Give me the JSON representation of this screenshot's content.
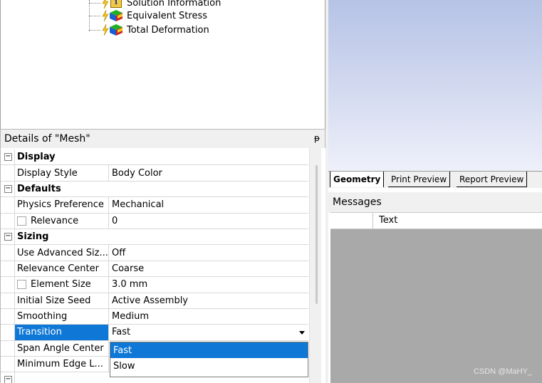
{
  "tree": {
    "items": [
      {
        "label": "Solution Information",
        "icon": "solution-information-icon"
      },
      {
        "label": "Equivalent Stress",
        "icon": "result-cube-icon"
      },
      {
        "label": "Total Deformation",
        "icon": "result-cube-icon"
      }
    ]
  },
  "details": {
    "title": "Details of \"Mesh\"",
    "pin_glyph": "ᵽ",
    "groups": {
      "display": "Display",
      "defaults": "Defaults",
      "sizing": "Sizing"
    },
    "rows": {
      "display_style": {
        "label": "Display Style",
        "value": "Body Color"
      },
      "physics_preference": {
        "label": "Physics Preference",
        "value": "Mechanical"
      },
      "relevance": {
        "label": "Relevance",
        "value": "0"
      },
      "use_advanced_size": {
        "label": "Use Advanced Siz...",
        "value": "Off"
      },
      "relevance_center": {
        "label": "Relevance Center",
        "value": "Coarse"
      },
      "element_size": {
        "label": "Element Size",
        "value": "3.0 mm"
      },
      "initial_size_seed": {
        "label": "Initial Size Seed",
        "value": "Active Assembly"
      },
      "smoothing": {
        "label": "Smoothing",
        "value": "Medium"
      },
      "transition": {
        "label": "Transition",
        "value": "Fast"
      },
      "span_angle_center": {
        "label": "Span Angle Center"
      },
      "minimum_edge_length": {
        "label": "Minimum Edge L..."
      }
    },
    "transition_options": [
      "Fast",
      "Slow"
    ],
    "transition_highlighted": "Fast"
  },
  "tabs": [
    "Geometry",
    "Print Preview",
    "Report Preview"
  ],
  "active_tab": "Geometry",
  "messages": {
    "title": "Messages",
    "columns": [
      "",
      "Text"
    ]
  },
  "watermark": "CSDN @MaHY_",
  "colors": {
    "selection": "#0f78d7",
    "viewport_top": "#b6c3e6",
    "messages_bg": "#a9a9a9"
  }
}
